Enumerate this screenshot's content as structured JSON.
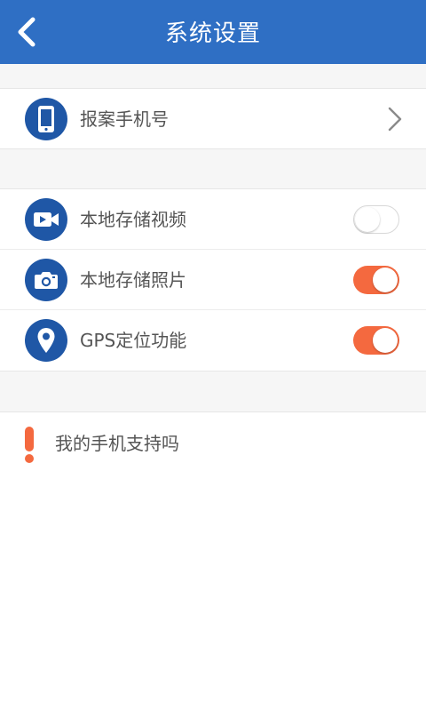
{
  "header": {
    "title": "系统设置",
    "back_icon": "chevron-left-icon"
  },
  "report_phone": {
    "label": "报案手机号",
    "icon": "phone-icon"
  },
  "toggles": [
    {
      "label": "本地存储视频",
      "icon": "video-camera-icon",
      "on": false
    },
    {
      "label": "本地存储照片",
      "icon": "camera-icon",
      "on": true
    },
    {
      "label": "GPS定位功能",
      "icon": "location-pin-icon",
      "on": true
    }
  ],
  "support": {
    "label": "我的手机支持吗",
    "icon": "exclamation-icon"
  },
  "colors": {
    "header_bg": "#2f6fc4",
    "icon_bg": "#1f57a6",
    "toggle_on": "#f4693f",
    "alert": "#f4693f"
  }
}
